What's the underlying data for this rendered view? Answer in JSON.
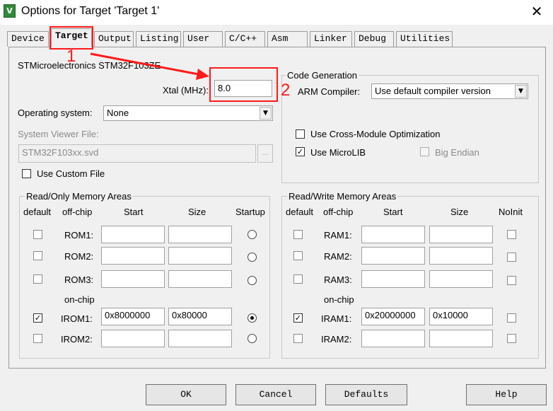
{
  "window": {
    "title": "Options for Target 'Target 1'",
    "close_glyph": "✕",
    "icon_letter": "V"
  },
  "tabs": [
    {
      "label": "Device",
      "active": false
    },
    {
      "label": "Target",
      "active": true
    },
    {
      "label": "Output",
      "active": false
    },
    {
      "label": "Listing",
      "active": false
    },
    {
      "label": "User",
      "active": false
    },
    {
      "label": "C/C++",
      "active": false
    },
    {
      "label": "Asm",
      "active": false
    },
    {
      "label": "Linker",
      "active": false
    },
    {
      "label": "Debug",
      "active": false
    },
    {
      "label": "Utilities",
      "active": false
    }
  ],
  "device_name": "STMicroelectronics STM32F103ZE",
  "xtal": {
    "label": "Xtal (MHz):",
    "value": "8.0"
  },
  "os": {
    "label": "Operating system:",
    "value": "None"
  },
  "sysview": {
    "label": "System Viewer File:",
    "value": "STM32F103xx.svd",
    "browse_label": "..."
  },
  "custom_file": {
    "label": "Use Custom File",
    "checked": false
  },
  "code_gen": {
    "title": "Code Generation",
    "compiler_label": "ARM Compiler:",
    "compiler_value": "Use default compiler version",
    "cross_module": {
      "label": "Use Cross-Module Optimization",
      "checked": false
    },
    "microlib": {
      "label": "Use MicroLIB",
      "checked": true
    },
    "big_endian": {
      "label": "Big Endian",
      "checked": false
    }
  },
  "rom": {
    "title": "Read/Only Memory Areas",
    "headers": {
      "default": "default",
      "offchip": "off-chip",
      "start": "Start",
      "size": "Size",
      "startup": "Startup"
    },
    "onchip_label": "on-chip",
    "rows": [
      {
        "name": "ROM1:",
        "default": false,
        "start": "",
        "size": "",
        "startup": false
      },
      {
        "name": "ROM2:",
        "default": false,
        "start": "",
        "size": "",
        "startup": false
      },
      {
        "name": "ROM3:",
        "default": false,
        "start": "",
        "size": "",
        "startup": false
      },
      {
        "name": "IROM1:",
        "default": true,
        "start": "0x8000000",
        "size": "0x80000",
        "startup": true
      },
      {
        "name": "IROM2:",
        "default": false,
        "start": "",
        "size": "",
        "startup": false
      }
    ]
  },
  "ram": {
    "title": "Read/Write Memory Areas",
    "headers": {
      "default": "default",
      "offchip": "off-chip",
      "start": "Start",
      "size": "Size",
      "noinit": "NoInit"
    },
    "onchip_label": "on-chip",
    "rows": [
      {
        "name": "RAM1:",
        "default": false,
        "start": "",
        "size": "",
        "noinit": false
      },
      {
        "name": "RAM2:",
        "default": false,
        "start": "",
        "size": "",
        "noinit": false
      },
      {
        "name": "RAM3:",
        "default": false,
        "start": "",
        "size": "",
        "noinit": false
      },
      {
        "name": "IRAM1:",
        "default": true,
        "start": "0x20000000",
        "size": "0x10000",
        "noinit": false
      },
      {
        "name": "IRAM2:",
        "default": false,
        "start": "",
        "size": "",
        "noinit": false
      }
    ]
  },
  "buttons": {
    "ok": "OK",
    "cancel": "Cancel",
    "defaults": "Defaults",
    "help": "Help"
  },
  "annotations": {
    "mark1": "1",
    "mark2": "2",
    "color": "#ff1a1a"
  },
  "check_glyph": "✓"
}
